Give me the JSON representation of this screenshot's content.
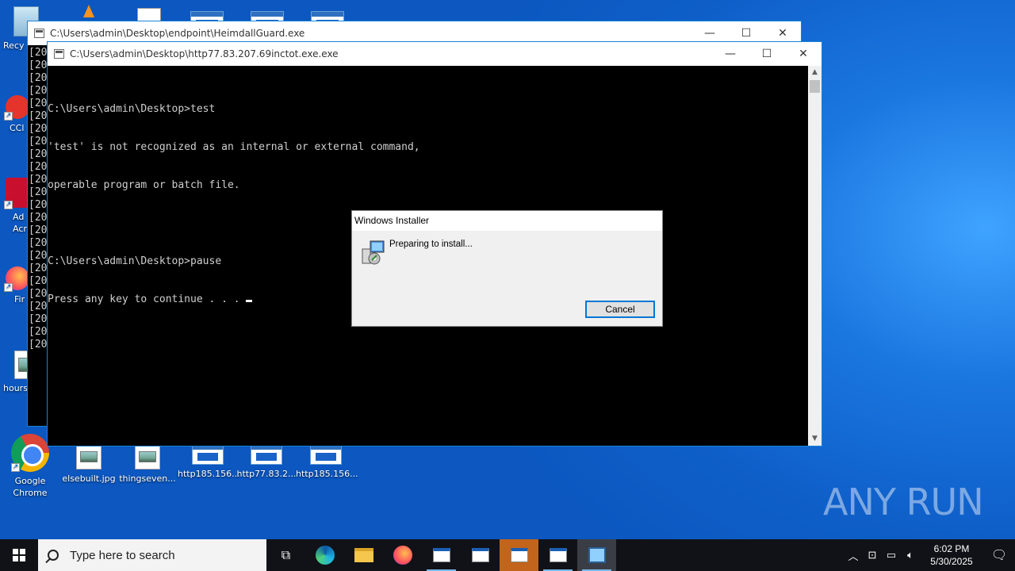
{
  "desktop": {
    "left_icons": [
      {
        "label": "Recy"
      },
      {
        "label": "CCl"
      },
      {
        "label": "Ad\nAcr"
      },
      {
        "label": "Fir"
      },
      {
        "label": "hours"
      }
    ],
    "bottom_icons": [
      {
        "label": "Google Chrome"
      },
      {
        "label": "elsebuilt.jpg"
      },
      {
        "label": "thingseven..."
      },
      {
        "label": "http185.156..."
      },
      {
        "label": "http77.83.2..."
      },
      {
        "label": "http185.156..."
      }
    ]
  },
  "window_back": {
    "title": "C:\\Users\\admin\\Desktop\\endpoint\\HeimdallGuard.exe",
    "log_prefix": "[20",
    "log_rows": 24
  },
  "window_front": {
    "title": "C:\\Users\\admin\\Desktop\\http77.83.207.69inctot.exe.exe",
    "console_lines": [
      "",
      "C:\\Users\\admin\\Desktop>test",
      "'test' is not recognized as an internal or external command,",
      "operable program or batch file.",
      "",
      "C:\\Users\\admin\\Desktop>pause",
      "Press any key to continue . . . "
    ]
  },
  "dialog": {
    "title": "Windows Installer",
    "message": "Preparing to install...",
    "cancel_label": "Cancel"
  },
  "taskbar": {
    "search_placeholder": "Type here to search",
    "time": "6:02 PM",
    "date": "5/30/2025"
  },
  "watermark": "ANY RUN"
}
